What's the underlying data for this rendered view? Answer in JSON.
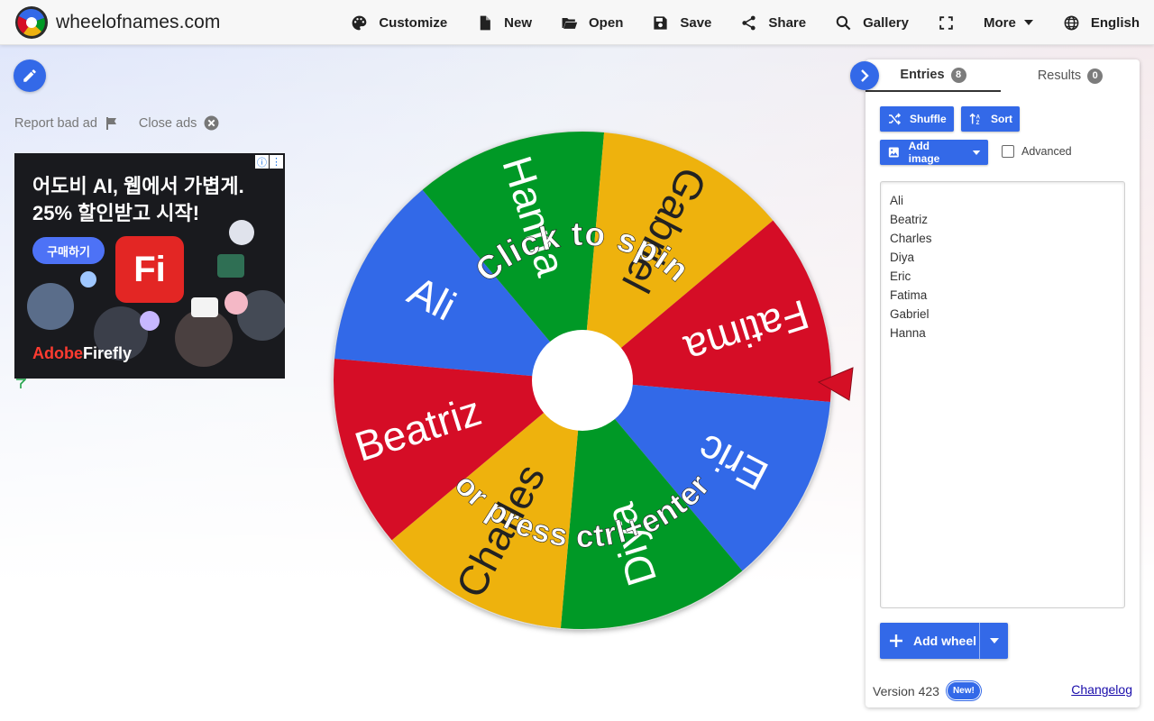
{
  "header": {
    "site_name": "wheelofnames.com",
    "nav": [
      {
        "label": "Customize",
        "icon": "palette-icon"
      },
      {
        "label": "New",
        "icon": "file-icon"
      },
      {
        "label": "Open",
        "icon": "folder-open-icon"
      },
      {
        "label": "Save",
        "icon": "save-icon"
      },
      {
        "label": "Share",
        "icon": "share-icon"
      },
      {
        "label": "Gallery",
        "icon": "search-icon"
      },
      {
        "label": "",
        "icon": "fullscreen-icon"
      },
      {
        "label": "More",
        "icon": "chevron-down-icon"
      },
      {
        "label": "English",
        "icon": "globe-icon"
      }
    ]
  },
  "ads": {
    "report_label": "Report bad ad",
    "close_label": "Close ads",
    "headline": "어도비 AI, 웹에서 가볍게.\n25% 할인받고 시작!",
    "cta": "구매하기",
    "app_mark": "Fi",
    "brand_a": "Adobe",
    "brand_b": "Firefly"
  },
  "wheel": {
    "click_text": "Click to spin",
    "press_text": "or press ctrl+enter",
    "colors": [
      "#3369e8",
      "#009925",
      "#eeb211",
      "#d50f25"
    ],
    "segments": [
      "Ali",
      "Hanna",
      "Gabriel",
      "Fatima",
      "Eric",
      "Diya",
      "Charles",
      "Beatriz"
    ]
  },
  "panel": {
    "tab_entries": "Entries",
    "entries_count": "8",
    "tab_results": "Results",
    "results_count": "0",
    "shuffle_label": "Shuffle",
    "sort_label": "Sort",
    "add_image_label": "Add image",
    "advanced_label": "Advanced",
    "entries": [
      "Ali",
      "Beatriz",
      "Charles",
      "Diya",
      "Eric",
      "Fatima",
      "Gabriel",
      "Hanna"
    ],
    "add_wheel_label": "Add wheel",
    "version_label": "Version 423",
    "new_badge": "New!",
    "changelog_label": "Changelog"
  }
}
